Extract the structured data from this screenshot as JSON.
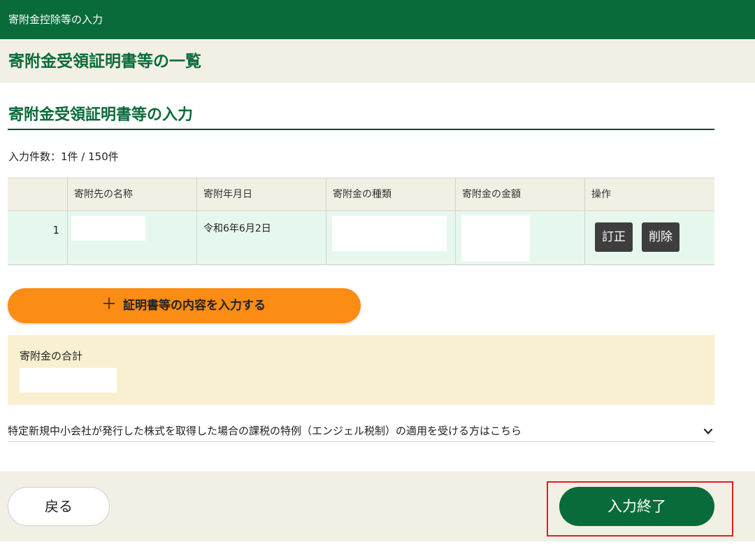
{
  "header": {
    "title": "寄附金控除等の入力"
  },
  "page": {
    "title": "寄附金受領証明書等の一覧"
  },
  "section": {
    "title": "寄附金受領証明書等の入力",
    "count_text": "入力件数：1件 / 150件"
  },
  "table": {
    "columns": [
      "",
      "寄附先の名称",
      "寄附年月日",
      "寄附金の種類",
      "寄附金の金額",
      "操作"
    ],
    "rows": [
      {
        "no": "1",
        "date": "令和6年6月2日",
        "edit_label": "訂正",
        "delete_label": "削除"
      }
    ]
  },
  "add_button": {
    "icon": "plus-icon",
    "label": "証明書等の内容を入力する"
  },
  "total": {
    "label": "寄附金の合計"
  },
  "angel_tax": {
    "text": "特定新規中小会社が発行した株式を取得した場合の課税の特例（エンジェル税制）の適用を受ける方はこちら",
    "icon": "chevron-down-icon"
  },
  "footer": {
    "back_label": "戻る",
    "finish_label": "入力終了"
  },
  "colors": {
    "brand_green": "#0a6b3a",
    "accent_orange": "#fb8c14",
    "highlight_red": "#e0201f",
    "row_green": "#e6f8ee",
    "total_bg": "#f9f0d2",
    "beige": "#f2efe4"
  }
}
